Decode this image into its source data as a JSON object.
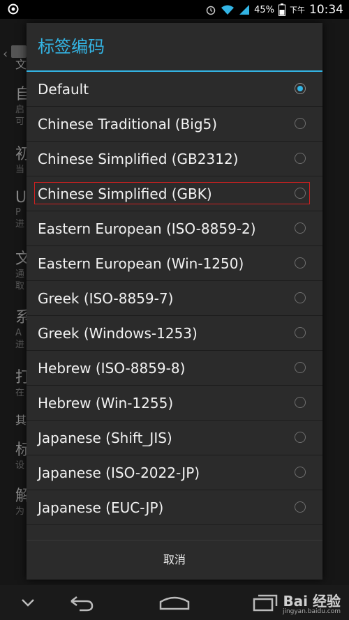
{
  "status_bar": {
    "battery": "45%",
    "ampm": "下午",
    "time": "10:34"
  },
  "background": {
    "items": [
      {
        "title": "文",
        "subtitle": ""
      },
      {
        "title": "自",
        "subtitle": "启\n可"
      },
      {
        "title": "初",
        "subtitle": "当"
      },
      {
        "title": "U",
        "subtitle": "P\n进"
      },
      {
        "title": "文",
        "subtitle": "通\n取"
      },
      {
        "title": "系",
        "subtitle": "A\n进"
      },
      {
        "title": "打",
        "subtitle": "在"
      },
      {
        "title": "其",
        "subtitle": ""
      },
      {
        "title": "标",
        "subtitle": "设"
      },
      {
        "title": "解",
        "subtitle": "为"
      }
    ]
  },
  "dialog": {
    "title": "标签编码",
    "options": [
      {
        "label": "Default",
        "checked": true
      },
      {
        "label": "Chinese Traditional (Big5)",
        "checked": false
      },
      {
        "label": "Chinese Simplified (GB2312)",
        "checked": false
      },
      {
        "label": "Chinese Simplified (GBK)",
        "checked": false,
        "highlighted": true
      },
      {
        "label": "Eastern European (ISO-8859-2)",
        "checked": false
      },
      {
        "label": "Eastern European (Win-1250)",
        "checked": false
      },
      {
        "label": "Greek (ISO-8859-7)",
        "checked": false
      },
      {
        "label": "Greek (Windows-1253)",
        "checked": false
      },
      {
        "label": "Hebrew (ISO-8859-8)",
        "checked": false
      },
      {
        "label": "Hebrew (Win-1255)",
        "checked": false
      },
      {
        "label": "Japanese (Shift_JIS)",
        "checked": false
      },
      {
        "label": "Japanese (ISO-2022-JP)",
        "checked": false
      },
      {
        "label": "Japanese (EUC-JP)",
        "checked": false
      }
    ],
    "cancel_label": "取消"
  },
  "watermark": {
    "text": "Bai 经验",
    "url": "jingyan.baidu.com"
  },
  "colors": {
    "accent": "#33b5e5",
    "highlight_box": "#d02020",
    "dialog_bg": "#2b2b2b"
  },
  "icons": {
    "status_left": "settings-gear-icon",
    "alarm": "alarm-icon",
    "wifi": "wifi-icon",
    "signal": "signal-icon",
    "battery": "battery-icon",
    "nav_menu": "chevron-down-icon",
    "nav_back": "back-arrow-icon",
    "nav_home": "home-icon",
    "nav_recent": "recent-apps-icon"
  }
}
